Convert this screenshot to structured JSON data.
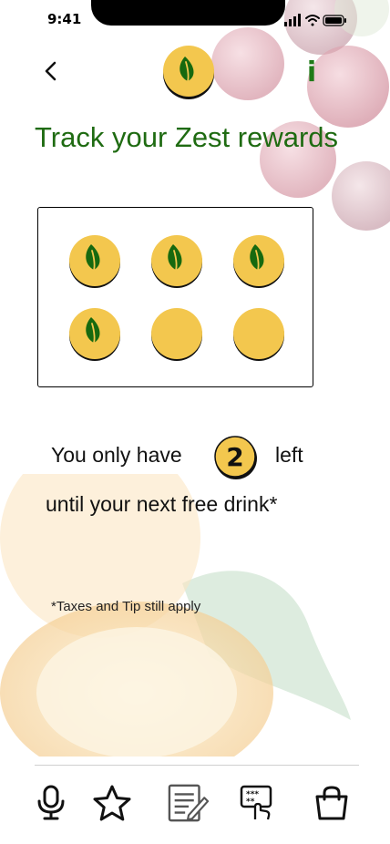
{
  "status_bar": {
    "time": "9:41"
  },
  "header": {
    "back_icon": "chevron-left-icon",
    "logo_icon": "leaf-logo-icon",
    "info_label": "i",
    "title": "Track your Zest rewards"
  },
  "stamp_card": {
    "total_stamps": 6,
    "collected_stamps": 4,
    "stamps": [
      {
        "collected": true
      },
      {
        "collected": true
      },
      {
        "collected": true
      },
      {
        "collected": true
      },
      {
        "collected": false
      },
      {
        "collected": false
      }
    ]
  },
  "message": {
    "line1_prefix": "You only have",
    "remaining_count": "2",
    "line1_suffix": "left",
    "line2": "until your next free drink*"
  },
  "disclaimer": "*Taxes and Tip still apply",
  "tab_bar": {
    "tabs": [
      {
        "icon": "microphone-icon"
      },
      {
        "icon": "star-icon"
      },
      {
        "icon": "notepad-edit-icon"
      },
      {
        "icon": "card-tap-icon"
      },
      {
        "icon": "shopping-bag-icon"
      }
    ]
  },
  "colors": {
    "brand_green": "#1f6b12",
    "leaf_green": "#17690f",
    "coin_yellow": "#f3c74e",
    "coin_border": "#111111"
  }
}
